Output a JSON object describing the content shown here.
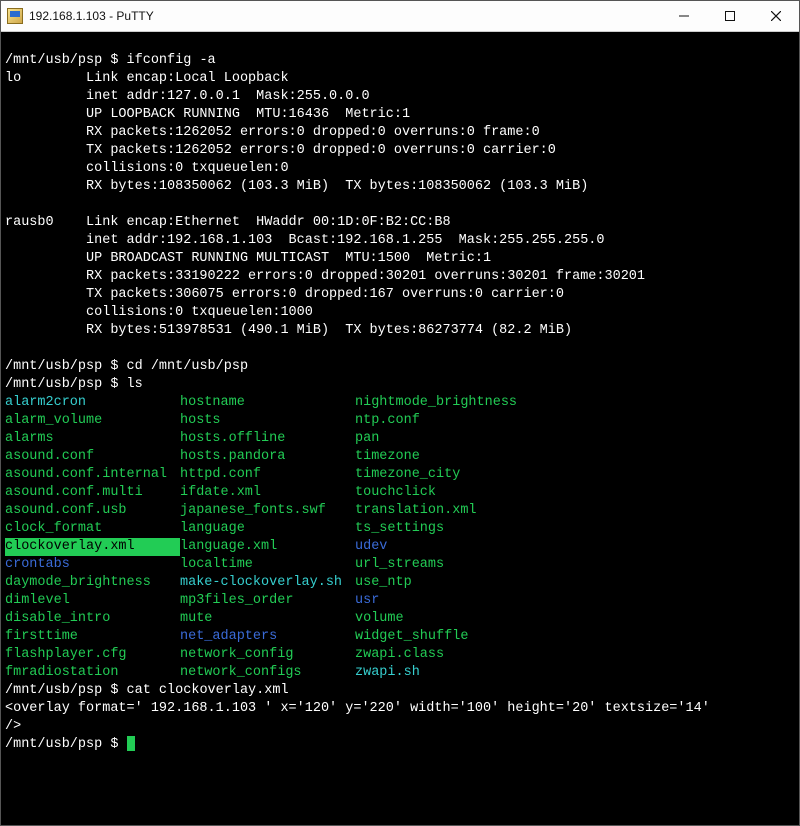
{
  "window": {
    "title": "192.168.1.103 - PuTTY"
  },
  "prompt": "/mnt/usb/psp $ ",
  "commands": {
    "ifconfig": "ifconfig -a",
    "cd": "cd /mnt/usb/psp",
    "ls": "ls",
    "cat": "cat clockoverlay.xml"
  },
  "ifconfig": {
    "lo": {
      "l1": "lo        Link encap:Local Loopback",
      "l2": "          inet addr:127.0.0.1  Mask:255.0.0.0",
      "l3": "          UP LOOPBACK RUNNING  MTU:16436  Metric:1",
      "l4": "          RX packets:1262052 errors:0 dropped:0 overruns:0 frame:0",
      "l5": "          TX packets:1262052 errors:0 dropped:0 overruns:0 carrier:0",
      "l6": "          collisions:0 txqueuelen:0",
      "l7": "          RX bytes:108350062 (103.3 MiB)  TX bytes:108350062 (103.3 MiB)"
    },
    "rausb0": {
      "l1": "rausb0    Link encap:Ethernet  HWaddr 00:1D:0F:B2:CC:B8",
      "l2": "          inet addr:192.168.1.103  Bcast:192.168.1.255  Mask:255.255.255.0",
      "l3": "          UP BROADCAST RUNNING MULTICAST  MTU:1500  Metric:1",
      "l4": "          RX packets:33190222 errors:0 dropped:30201 overruns:30201 frame:30201",
      "l5": "          TX packets:306075 errors:0 dropped:167 overruns:0 carrier:0",
      "l6": "          collisions:0 txqueuelen:1000",
      "l7": "          RX bytes:513978531 (490.1 MiB)  TX bytes:86273774 (82.2 MiB)"
    }
  },
  "ls": {
    "col1": [
      {
        "name": "alarm2cron",
        "type": "exec"
      },
      {
        "name": "alarm_volume",
        "type": "file"
      },
      {
        "name": "alarms",
        "type": "file"
      },
      {
        "name": "asound.conf",
        "type": "file"
      },
      {
        "name": "asound.conf.internal",
        "type": "file"
      },
      {
        "name": "asound.conf.multi",
        "type": "file"
      },
      {
        "name": "asound.conf.usb",
        "type": "file"
      },
      {
        "name": "clock_format",
        "type": "file"
      },
      {
        "name": "clockoverlay.xml",
        "type": "selected"
      },
      {
        "name": "crontabs",
        "type": "dir"
      },
      {
        "name": "daymode_brightness",
        "type": "file"
      },
      {
        "name": "dimlevel",
        "type": "file"
      },
      {
        "name": "disable_intro",
        "type": "file"
      },
      {
        "name": "firsttime",
        "type": "file"
      },
      {
        "name": "flashplayer.cfg",
        "type": "file"
      },
      {
        "name": "fmradiostation",
        "type": "file"
      }
    ],
    "col2": [
      {
        "name": "hostname",
        "type": "file"
      },
      {
        "name": "hosts",
        "type": "file"
      },
      {
        "name": "hosts.offline",
        "type": "file"
      },
      {
        "name": "hosts.pandora",
        "type": "file"
      },
      {
        "name": "httpd.conf",
        "type": "file"
      },
      {
        "name": "ifdate.xml",
        "type": "file"
      },
      {
        "name": "japanese_fonts.swf",
        "type": "file"
      },
      {
        "name": "language",
        "type": "file"
      },
      {
        "name": "language.xml",
        "type": "file"
      },
      {
        "name": "localtime",
        "type": "file"
      },
      {
        "name": "make-clockoverlay.sh",
        "type": "exec"
      },
      {
        "name": "mp3files_order",
        "type": "file"
      },
      {
        "name": "mute",
        "type": "file"
      },
      {
        "name": "net_adapters",
        "type": "dir"
      },
      {
        "name": "network_config",
        "type": "file"
      },
      {
        "name": "network_configs",
        "type": "file"
      }
    ],
    "col3": [
      {
        "name": "nightmode_brightness",
        "type": "file"
      },
      {
        "name": "ntp.conf",
        "type": "file"
      },
      {
        "name": "pan",
        "type": "file"
      },
      {
        "name": "timezone",
        "type": "file"
      },
      {
        "name": "timezone_city",
        "type": "file"
      },
      {
        "name": "touchclick",
        "type": "file"
      },
      {
        "name": "translation.xml",
        "type": "file"
      },
      {
        "name": "ts_settings",
        "type": "file"
      },
      {
        "name": "udev",
        "type": "dir"
      },
      {
        "name": "url_streams",
        "type": "file"
      },
      {
        "name": "use_ntp",
        "type": "file"
      },
      {
        "name": "usr",
        "type": "dir"
      },
      {
        "name": "volume",
        "type": "file"
      },
      {
        "name": "widget_shuffle",
        "type": "file"
      },
      {
        "name": "zwapi.class",
        "type": "file"
      },
      {
        "name": "zwapi.sh",
        "type": "exec"
      }
    ]
  },
  "cat_output": {
    "l1": "<overlay format=' 192.168.1.103 ' x='120' y='220' width='100' height='20' textsize='14'",
    "l2": "/>"
  }
}
